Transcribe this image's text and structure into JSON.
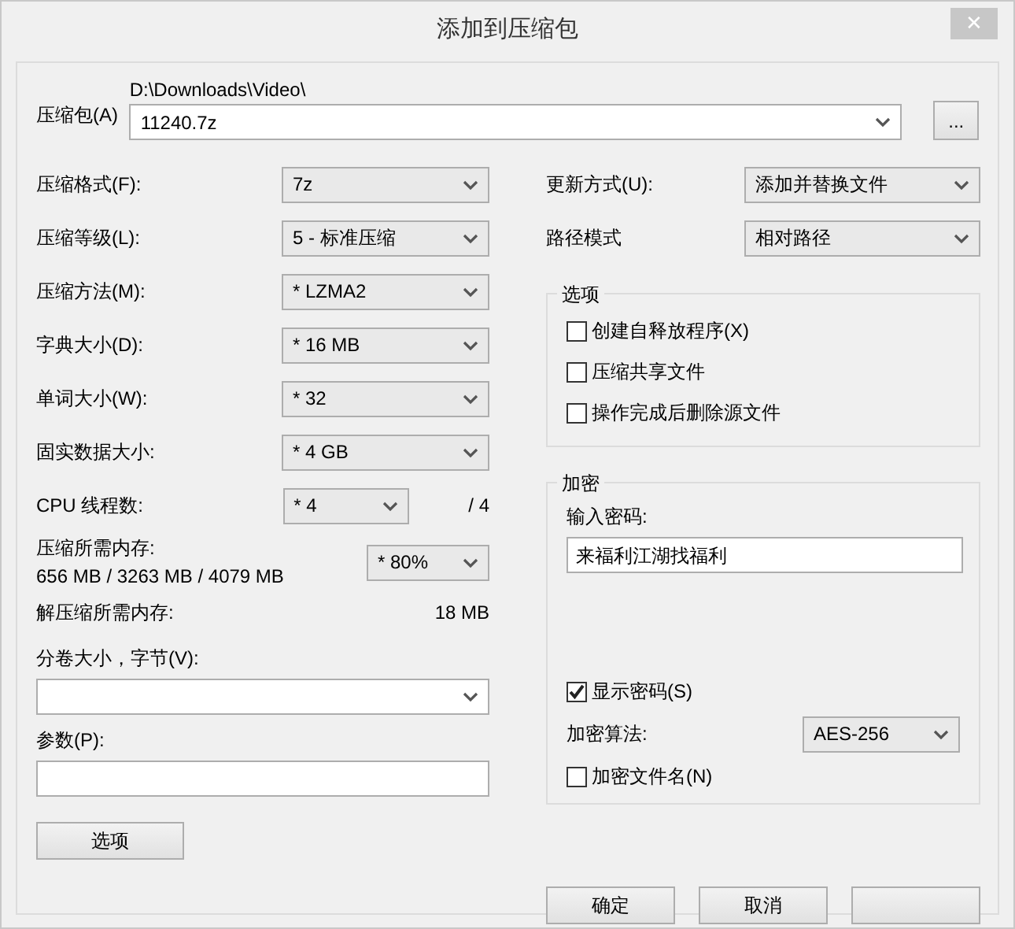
{
  "window": {
    "title": "添加到压缩包",
    "close": "✕"
  },
  "archive": {
    "label": "压缩包(A)",
    "path": "D:\\Downloads\\Video\\",
    "value": "11240.7z",
    "browse": "..."
  },
  "left_rows": [
    {
      "kind": "select",
      "label": "压缩格式(F):",
      "value": "7z"
    },
    {
      "kind": "select",
      "label": "压缩等级(L):",
      "value": "5 - 标准压缩"
    },
    {
      "kind": "select",
      "label": "压缩方法(M):",
      "value": "* LZMA2"
    },
    {
      "kind": "select",
      "label": "字典大小(D):",
      "value": "* 16 MB"
    },
    {
      "kind": "select",
      "label": "单词大小(W):",
      "value": "* 32"
    },
    {
      "kind": "select",
      "label": "固实数据大小:",
      "value": "* 4 GB"
    },
    {
      "kind": "threads",
      "label": "CPU 线程数:",
      "value": "* 4",
      "suffix": "/ 4"
    },
    {
      "kind": "memory",
      "label": "压缩所需内存:",
      "detail": "656 MB / 3263 MB / 4079 MB",
      "value": "* 80%"
    },
    {
      "kind": "info",
      "label": "解压缩所需内存:",
      "value": "18 MB"
    },
    {
      "kind": "wide_select",
      "label": "分卷大小，字节(V):"
    },
    {
      "kind": "wide_input",
      "label": "参数(P):"
    }
  ],
  "options_button": "选项",
  "right_rows": [
    {
      "label": "更新方式(U):",
      "value": "添加并替换文件"
    },
    {
      "label": "路径模式",
      "value": "相对路径"
    }
  ],
  "options_group": {
    "title": "选项",
    "checkboxes": [
      {
        "label": "创建自释放程序(X)",
        "checked": false
      },
      {
        "label": "压缩共享文件",
        "checked": false
      },
      {
        "label": "操作完成后删除源文件",
        "checked": false
      }
    ]
  },
  "encryption": {
    "title": "加密",
    "password_label": "输入密码:",
    "password": "来福利江湖找福利",
    "show_password": {
      "label": "显示密码(S)",
      "checked": true
    },
    "method_label": "加密算法:",
    "method": "AES-256",
    "encrypt_names": {
      "label": "加密文件名(N)",
      "checked": false
    }
  },
  "buttons": [
    {
      "kind": "text",
      "label": "确定"
    },
    {
      "kind": "text",
      "label": "取消"
    },
    {
      "kind": "blank"
    }
  ]
}
